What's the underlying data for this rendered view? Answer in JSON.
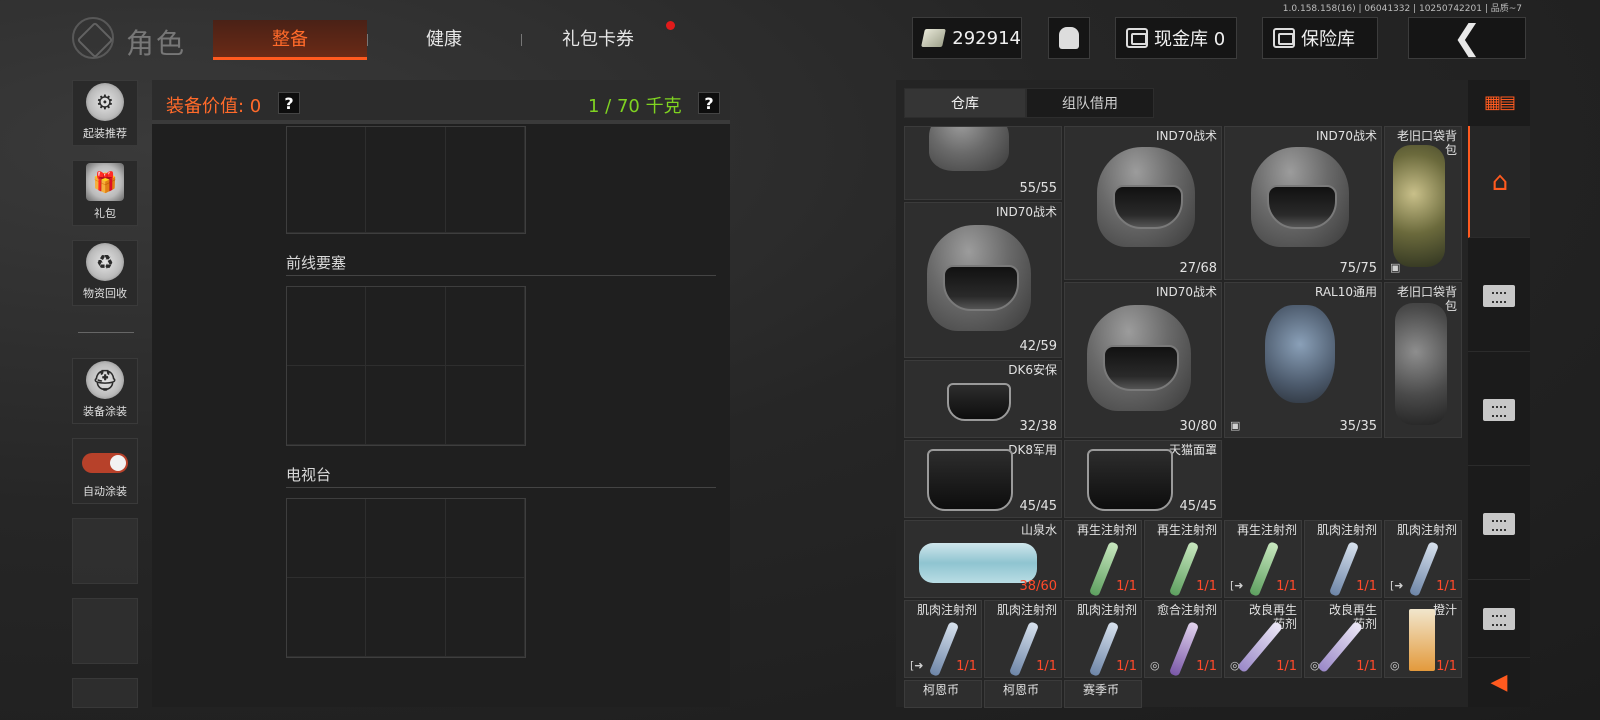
{
  "version_text": "1.0.158.158(16) | 06041332 | 10250742201 | 品质~7",
  "header": {
    "title": "角色",
    "tabs": [
      {
        "label": "整备",
        "active": true
      },
      {
        "label": "健康",
        "active": false
      },
      {
        "label": "礼包卡券",
        "active": false,
        "has_notification": true
      }
    ],
    "money": "292914",
    "cash_vault_label": "现金库 0",
    "safe_label": "保险库"
  },
  "sidebar": {
    "items": [
      {
        "label": "起装推荐",
        "icon": "helmet-gear-icon"
      },
      {
        "label": "礼包",
        "icon": "gift-icon"
      },
      {
        "label": "物资回收",
        "icon": "recycle-icon"
      },
      {
        "label": "装备涂装",
        "icon": "paint-helmet-icon"
      },
      {
        "label": "自动涂装",
        "icon": "toggle-icon",
        "toggle_on": true
      }
    ]
  },
  "equipment": {
    "value_label": "装备价值: 0",
    "weight_label": "1 / 70 千克",
    "help": "?",
    "sections": [
      "前线要塞",
      "电视台"
    ]
  },
  "warehouse": {
    "tabs": [
      {
        "label": "仓库",
        "active": true
      },
      {
        "label": "组队借用",
        "active": false
      }
    ],
    "items": [
      {
        "name": "",
        "count": "55/55"
      },
      {
        "name": "IND70战术",
        "count": "27/68"
      },
      {
        "name": "IND70战术",
        "count": "75/75"
      },
      {
        "name": "老旧口袋背包",
        "count": ""
      },
      {
        "name": "IND70战术",
        "count": "42/59"
      },
      {
        "name": "IND70战术",
        "count": "30/80"
      },
      {
        "name": "RAL10通用",
        "count": "35/35"
      },
      {
        "name": "老旧口袋背包",
        "count": ""
      },
      {
        "name": "DK6安保",
        "count": "32/38"
      },
      {
        "name": "DK8军用",
        "count": "45/45"
      },
      {
        "name": "天猫面罩",
        "count": "45/45"
      },
      {
        "name": "山泉水",
        "count": "38/60"
      },
      {
        "name": "再生注射剂",
        "count": "1/1"
      },
      {
        "name": "再生注射剂",
        "count": "1/1"
      },
      {
        "name": "再生注射剂",
        "count": "1/1"
      },
      {
        "name": "肌肉注射剂",
        "count": "1/1"
      },
      {
        "name": "肌肉注射剂",
        "count": "1/1"
      },
      {
        "name": "肌肉注射剂",
        "count": "1/1"
      },
      {
        "name": "肌肉注射剂",
        "count": "1/1"
      },
      {
        "name": "肌肉注射剂",
        "count": "1/1"
      },
      {
        "name": "愈合注射剂",
        "count": "1/1"
      },
      {
        "name": "改良再生药剂",
        "count": "1/1"
      },
      {
        "name": "改良再生药剂",
        "count": "1/1"
      },
      {
        "name": "橙汁",
        "count": "1/1"
      },
      {
        "name": "柯恩币",
        "count": ""
      },
      {
        "name": "柯恩币",
        "count": ""
      },
      {
        "name": "赛季币",
        "count": ""
      }
    ]
  },
  "colors": {
    "accent": "#ff5a1f",
    "weight_green": "#7fd321",
    "count_red": "#ff4a2a"
  }
}
